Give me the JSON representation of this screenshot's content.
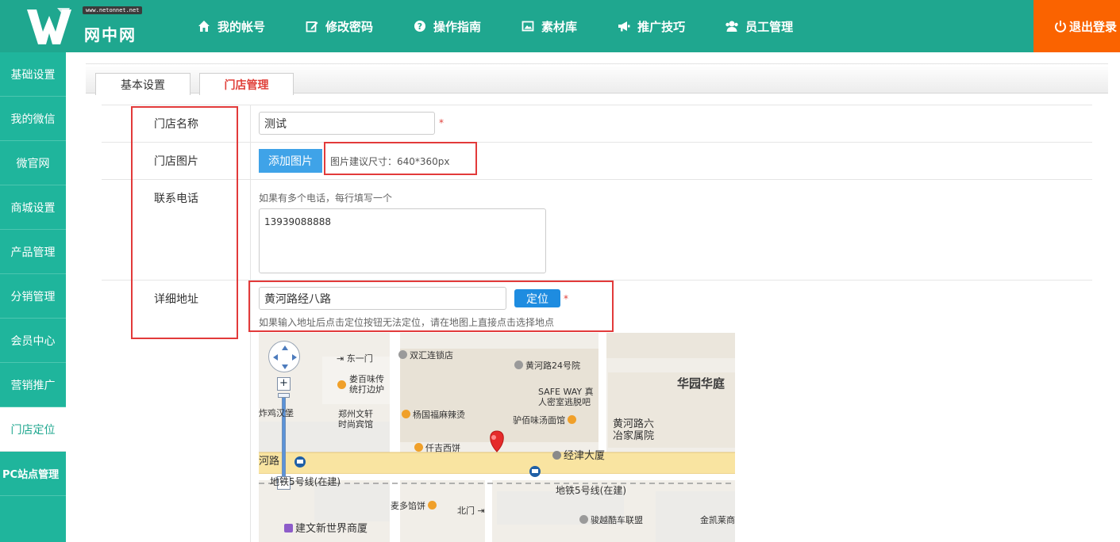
{
  "header": {
    "logo_tag": "www.netonnet.net",
    "logo_text": "网中网",
    "nav": [
      {
        "label": "我的帐号",
        "icon": "home-icon"
      },
      {
        "label": "修改密码",
        "icon": "edit-icon"
      },
      {
        "label": "操作指南",
        "icon": "help-icon"
      },
      {
        "label": "素材库",
        "icon": "image-library-icon"
      },
      {
        "label": "推广技巧",
        "icon": "megaphone-icon"
      },
      {
        "label": "员工管理",
        "icon": "users-icon"
      }
    ],
    "logout": "退出登录"
  },
  "sidebar": {
    "items": [
      "基础设置",
      "我的微信",
      "微官网",
      "商城设置",
      "产品管理",
      "分销管理",
      "会员中心",
      "营销推广",
      "门店定位",
      "PC站点管理"
    ],
    "active_index": 8
  },
  "tabs": [
    "基本设置",
    "门店管理"
  ],
  "form": {
    "store_name_label": "门店名称",
    "store_name_value": "测试",
    "store_image_label": "门店图片",
    "add_image_button": "添加图片",
    "image_size_hint": "图片建议尺寸：640*360px",
    "phone_label": "联系电话",
    "phone_hint": "如果有多个电话，每行填写一个",
    "phone_value": "13939088888",
    "address_label": "详细地址",
    "address_value": "黄河路经八路",
    "locate_button": "定位",
    "address_hint": "如果输入地址后点击定位按钮无法定位，请在地图上直接点击选择地点",
    "required_mark": "*"
  },
  "map": {
    "labels": {
      "dongyimen": "东一门",
      "shuanghui": "双汇连锁店",
      "huanghe24": "黄河路24号院",
      "loubai_1": "娄百味传",
      "loubai_2": "统打边炉",
      "huayuan": "华园华庭",
      "safeway_1": "SAFE WAY 真",
      "safeway_2": "人密室逃脱吧",
      "zhajixiao": "炸鸡汉堡",
      "zhengzhou_1": "郑州文轩",
      "zhengzhou_2": "时尚宾馆",
      "yangguofu": "杨国福麻辣烫",
      "lvbai": "驴佰味汤面馆",
      "huanghe6_1": "黄河路六",
      "huanghe6_2": "冶家属院",
      "qianji": "仟吉西饼",
      "jingjin": "经津大厦",
      "road_he": "河路",
      "metro_a": "地铁5号线(在建)",
      "metro_b": "地铁5号线(在建)",
      "maiduo": "麦多馅饼",
      "beimen": "北门",
      "junyue": "骏越酷车联盟",
      "jinkai": "金凯莱商",
      "jianwen": "建文新世界商厦"
    }
  },
  "colors": {
    "header_bg": "#1fa78f",
    "sidebar_bg": "#1fb59c",
    "logout_bg": "#fa6300",
    "accent_red": "#e0413b",
    "button_blue": "#3fa3e8"
  }
}
